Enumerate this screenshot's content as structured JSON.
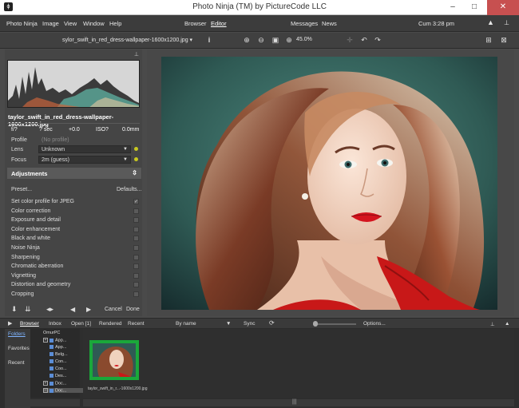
{
  "window": {
    "title": "Photo Ninja (TM) by PictureCode LLC",
    "controls": [
      "–",
      "□",
      "✕"
    ]
  },
  "menubar": {
    "items": [
      "Photo Ninja",
      "Image",
      "View",
      "Window",
      "Help"
    ],
    "modes": [
      "Browser",
      "Editor"
    ],
    "active_mode": "Editor",
    "extras": [
      "Messages",
      "News"
    ],
    "clock": "Cum 3:28 pm"
  },
  "toolbar": {
    "filename": "sylor_swift_in_red_dress-wallpaper-1600x1200.jpg",
    "zoom": "45.0%"
  },
  "left": {
    "filename": "taylor_swift_in_red_dress-wallpaper-1600x1200.jpg",
    "exif": {
      "aperture": "f/?",
      "shutter": "? sec",
      "ev": "+0.0",
      "iso": "ISO?",
      "focal": "0.0mm"
    },
    "profile_label": "Profile",
    "profile_value": "(No profile)",
    "lens_label": "Lens",
    "lens_value": "Unknown",
    "focus_label": "Focus",
    "focus_value": "2m (guess)",
    "adjustments_title": "Adjustments",
    "preset_label": "Preset...",
    "defaults_label": "Defaults...",
    "adjustments": [
      {
        "label": "Set color profile for JPEG",
        "checked": true
      },
      {
        "label": "Color correction",
        "checked": false
      },
      {
        "label": "Exposure and detail",
        "checked": false
      },
      {
        "label": "Color enhancement",
        "checked": false
      },
      {
        "label": "Black and white",
        "checked": false
      },
      {
        "label": "Noise Ninja",
        "checked": false
      },
      {
        "label": "Sharpening",
        "checked": false
      },
      {
        "label": "Chromatic aberration",
        "checked": false
      },
      {
        "label": "Vignetting",
        "checked": false
      },
      {
        "label": "Distortion and geometry",
        "checked": false
      },
      {
        "label": "Cropping",
        "checked": false
      }
    ],
    "cancel_label": "Cancel",
    "done_label": "Done"
  },
  "browser_bar": {
    "tabs": [
      "Browser",
      "Inbox",
      "Open [1]",
      "Rendered",
      "Recent"
    ],
    "active_tab": "Browser",
    "sort": "By name",
    "sync": "Sync",
    "options": "Options..."
  },
  "lower": {
    "nav": [
      "Folders",
      "Favorites",
      "Recent"
    ],
    "active_nav": "Folders",
    "tree": [
      "OmurPC",
      "App...",
      "App...",
      "Belg...",
      "Con...",
      "Coo...",
      "Des...",
      "Doc...",
      "Doc..."
    ],
    "thumb_caption": "taylor_swift_in_r...-1600x1200.jpg"
  },
  "colors": {
    "accent_green": "#1aa83a",
    "lips_red": "#d4141e",
    "dress_red": "#c81818",
    "background_teal": "#2f5a54",
    "dot_yellow": "#c8c820"
  }
}
